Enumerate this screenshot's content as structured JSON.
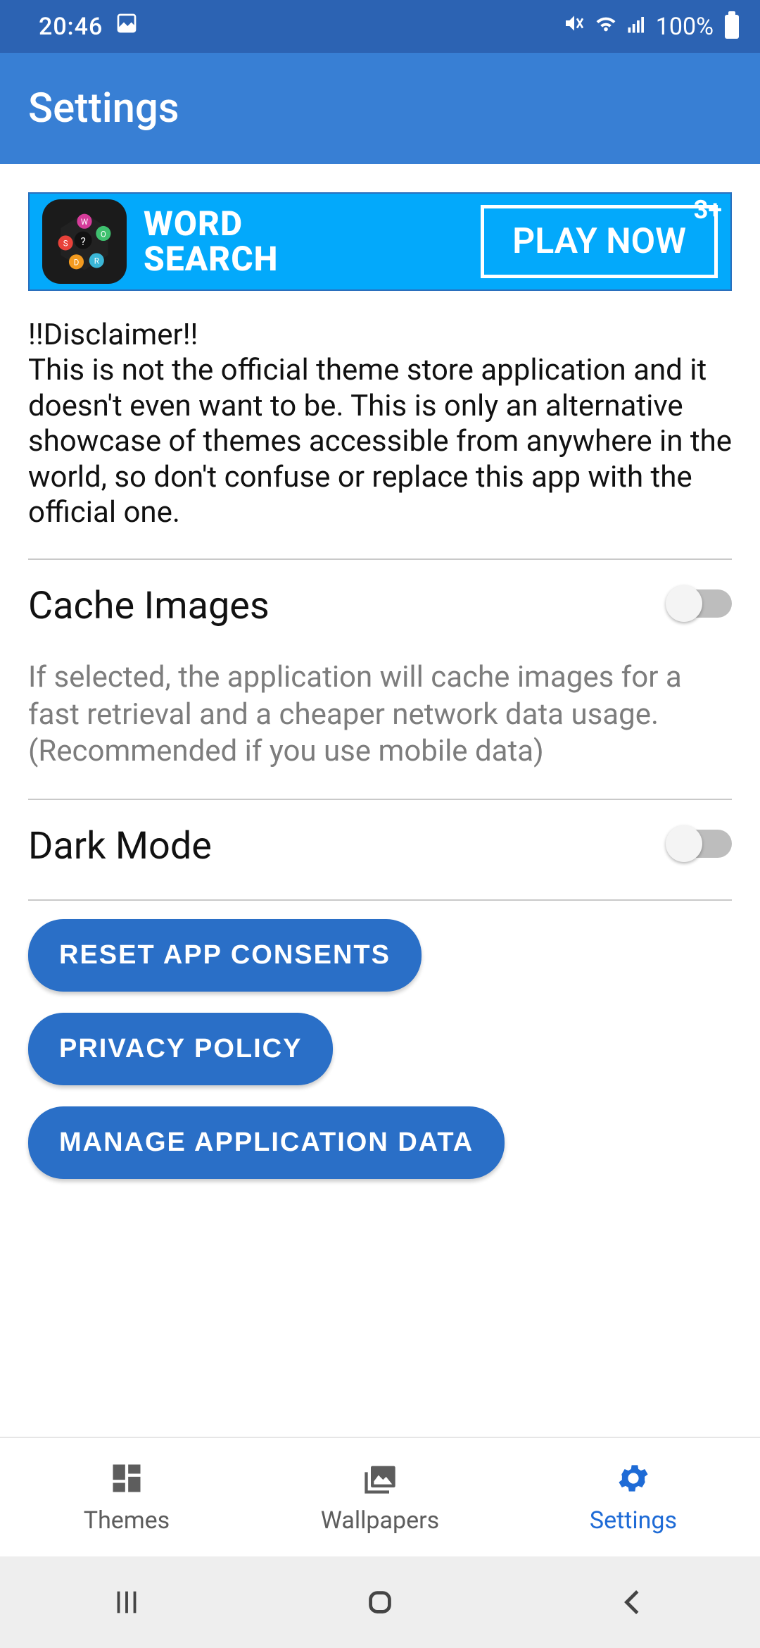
{
  "status": {
    "time": "20:46",
    "battery": "100%"
  },
  "appbar": {
    "title": "Settings"
  },
  "ad": {
    "title_line1": "WORD",
    "title_line2": "SEARCH",
    "cta": "PLAY NOW",
    "age": "3+"
  },
  "disclaimer": {
    "title": "!!Disclaimer!!",
    "body": "This is not the official theme store application and it doesn't even want to be. This is only an alternative showcase of themes accessible from anywhere in the world, so don't confuse or replace this app with the official one."
  },
  "settings": {
    "cache": {
      "title": "Cache Images",
      "desc": "If selected, the application will cache images for a fast retrieval and a cheaper network data usage. (Recommended if you use mobile data)",
      "value": false
    },
    "dark": {
      "title": "Dark Mode",
      "value": false
    }
  },
  "buttons": {
    "reset": "RESET APP CONSENTS",
    "privacy": "PRIVACY POLICY",
    "manage": "MANAGE APPLICATION DATA"
  },
  "nav": {
    "themes": "Themes",
    "wallpapers": "Wallpapers",
    "settings": "Settings"
  }
}
